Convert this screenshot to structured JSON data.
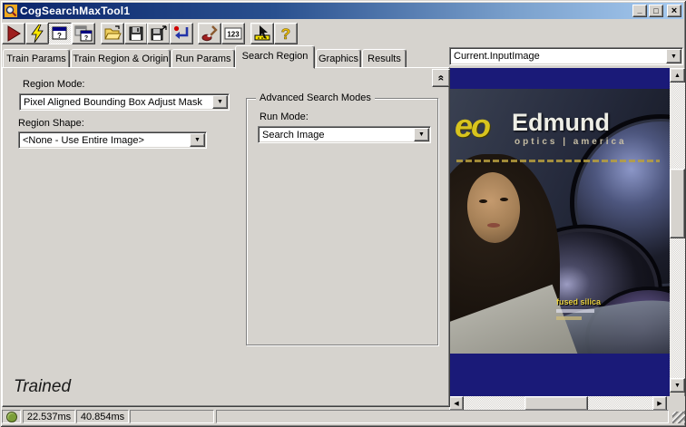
{
  "window": {
    "title": "CogSearchMaxTool1"
  },
  "titlebar": {
    "minimize_glyph": "_",
    "maximize_glyph": "□",
    "close_glyph": "×"
  },
  "toolbar": {
    "buttons": [
      "run-button",
      "electric-run-button",
      "local-display-toggle",
      "floating-display-button",
      "open-file-button",
      "save-button",
      "save-as-button",
      "reset-button",
      "electrode-button",
      "counter-button",
      "pointer-tool-button",
      "help-button"
    ],
    "counter_label": "123",
    "help_glyph": "?",
    "window_help_glyph": "?"
  },
  "tabs": {
    "items": [
      "Train Params",
      "Train Region & Origin",
      "Run Params",
      "Search Region",
      "Graphics",
      "Results"
    ],
    "active": "Search Region"
  },
  "search_region": {
    "region_mode_label": "Region Mode:",
    "region_mode_value": "Pixel Aligned Bounding Box Adjust Mask",
    "region_shape_label": "Region Shape:",
    "region_shape_value": "<None - Use Entire Image>",
    "advanced_group_title": "Advanced Search Modes",
    "run_mode_label": "Run Mode:",
    "run_mode_value": "Search Image",
    "collapse_glyph": "«",
    "trained_status": "Trained"
  },
  "image_panel": {
    "source_selector_value": "Current.InputImage",
    "cover": {
      "logo": "eo",
      "title": "Edmund",
      "subtitle": "optics | america",
      "caption": "fused silica"
    }
  },
  "status_bar": {
    "run_time": "22.537ms",
    "total_time": "40.854ms"
  },
  "icons": {
    "dropdown_arrow": "▼",
    "scroll_up": "▲",
    "scroll_down": "▼",
    "scroll_left": "◀",
    "scroll_right": "▶"
  },
  "colors": {
    "titlebar_start": "#0a246a",
    "titlebar_end": "#a6caf0",
    "chrome": "#d6d3ce",
    "navy_band": "#1a1a78",
    "status_green": "#7b9e38",
    "logo_yellow": "#d8c41e"
  }
}
